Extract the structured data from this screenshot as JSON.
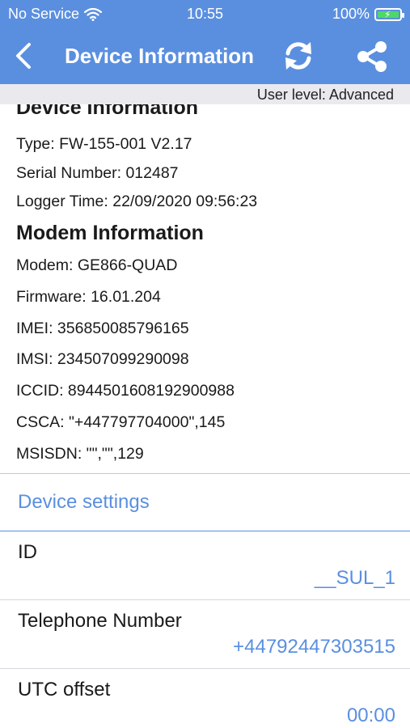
{
  "status": {
    "carrier": "No Service",
    "time": "10:55",
    "battery": "100%"
  },
  "navbar": {
    "title": "Device Information"
  },
  "user_level": "User level: Advanced",
  "device_info": {
    "title": "Device Information",
    "lines": [
      "Type: FW-155-001 V2.17",
      "Serial Number:  012487",
      "Logger Time: 22/09/2020 09:56:23"
    ]
  },
  "modem_info": {
    "title": "Modem Information",
    "lines": [
      "Modem: GE866-QUAD",
      "Firmware: 16.01.204",
      "IMEI: 356850085796165",
      "IMSI: 234507099290098",
      "ICCID: 8944501608192900988",
      "CSCA: \"+447797704000\",145",
      "MSISDN: \"\",\"\",129"
    ]
  },
  "settings": {
    "header": "Device settings",
    "rows": [
      {
        "label": "ID",
        "value": "__SUL_1"
      },
      {
        "label": "Telephone Number",
        "value": "+44792447303515"
      },
      {
        "label": "UTC offset",
        "value": "00:00"
      }
    ]
  },
  "colors": {
    "accent": "#5a8fe0",
    "battery": "#4cd964"
  },
  "icons": [
    "wifi-icon",
    "battery-icon",
    "back-chevron-icon",
    "refresh-icon",
    "share-icon"
  ]
}
